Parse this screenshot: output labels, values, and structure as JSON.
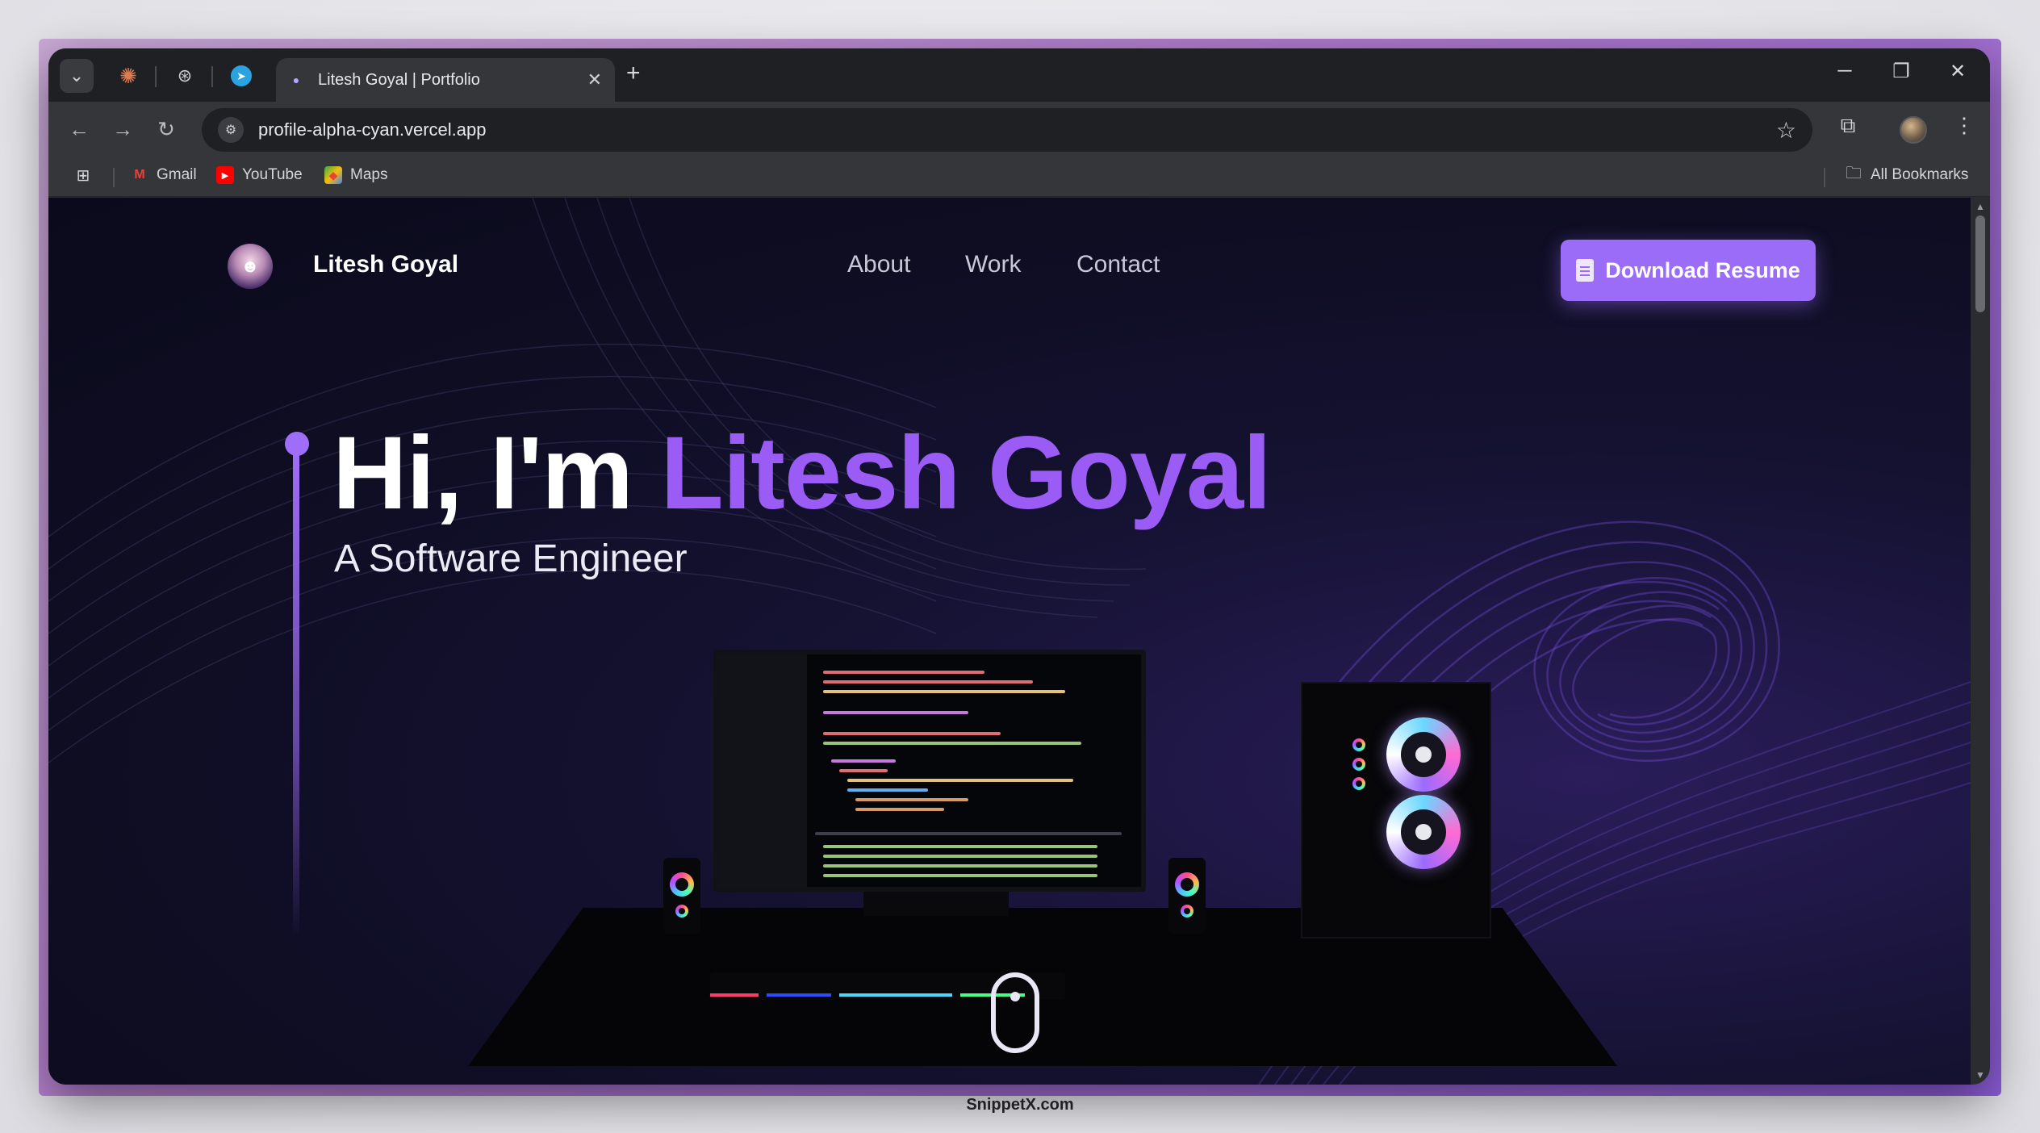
{
  "browser": {
    "tabs": {
      "active_title": "Litesh Goyal | Portfolio",
      "pinned_icons": [
        "claude-icon",
        "openai-icon",
        "telegram-icon"
      ]
    },
    "address_bar": {
      "url": "profile-alpha-cyan.vercel.app"
    },
    "bookmarks": {
      "items": [
        {
          "label": "Gmail",
          "icon": "gmail-icon"
        },
        {
          "label": "YouTube",
          "icon": "youtube-icon"
        },
        {
          "label": "Maps",
          "icon": "maps-icon"
        }
      ],
      "all_label": "All Bookmarks"
    }
  },
  "site": {
    "brand_name": "Litesh Goyal",
    "nav": [
      "About",
      "Work",
      "Contact"
    ],
    "cta_label": "Download Resume",
    "hero": {
      "greeting": "Hi, I'm",
      "name": "Litesh Goyal",
      "subtitle": "A Software Engineer"
    },
    "accent_color": "#9b5cf6"
  },
  "watermark": "SnippetX.com"
}
